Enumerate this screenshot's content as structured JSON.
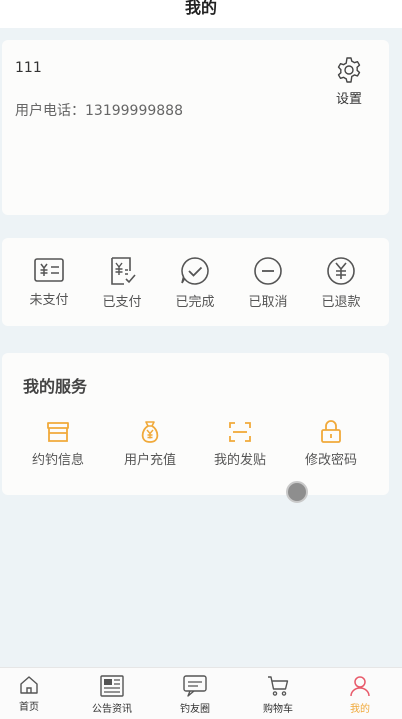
{
  "header": {
    "title": "我的"
  },
  "profile": {
    "username": "111",
    "phone_label": "用户电话：",
    "phone": "13199999888",
    "settings_label": "设置"
  },
  "orders": [
    {
      "label": "未支付",
      "icon": "unpaid-icon"
    },
    {
      "label": "已支付",
      "icon": "paid-icon"
    },
    {
      "label": "已完成",
      "icon": "completed-icon"
    },
    {
      "label": "已取消",
      "icon": "cancelled-icon"
    },
    {
      "label": "已退款",
      "icon": "refunded-icon"
    }
  ],
  "services": {
    "title": "我的服务",
    "items": [
      {
        "label": "约钓信息",
        "icon": "store-icon"
      },
      {
        "label": "用户充值",
        "icon": "money-bag-icon"
      },
      {
        "label": "我的发贴",
        "icon": "scan-icon"
      },
      {
        "label": "修改密码",
        "icon": "lock-icon"
      }
    ]
  },
  "tabs": [
    {
      "label": "首页",
      "icon": "home-icon"
    },
    {
      "label": "公告资讯",
      "icon": "news-icon"
    },
    {
      "label": "钓友圈",
      "icon": "chat-icon"
    },
    {
      "label": "购物车",
      "icon": "cart-icon"
    },
    {
      "label": "我的",
      "icon": "user-icon",
      "active": true
    }
  ],
  "colors": {
    "accent": "#f0a93a",
    "icon_gray": "#555555",
    "background": "#edf3f6"
  }
}
